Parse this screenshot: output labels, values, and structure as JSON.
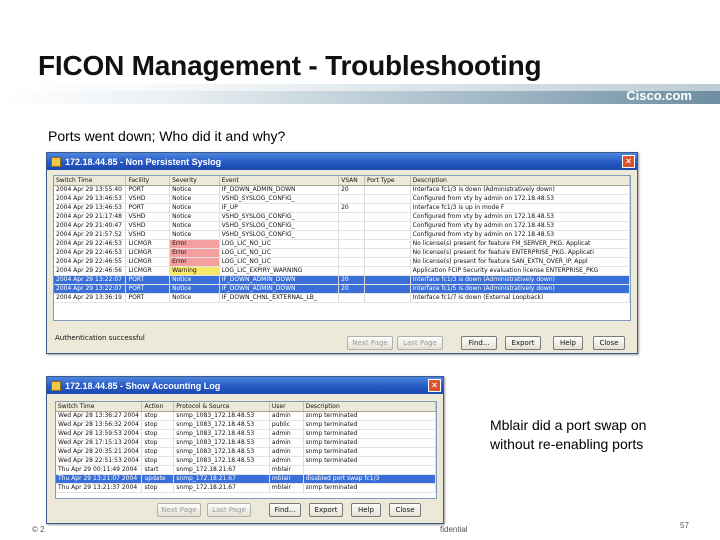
{
  "slide": {
    "title": "FICON Management - Troubleshooting",
    "brand": "Cisco.com",
    "subtitle": "Ports went down; Who did it and why?",
    "callout_line1": "Mblair did a port swap on",
    "callout_line2": "without re-enabling ports",
    "footer_left": "© 2",
    "footer_mid": "fidential",
    "page_number": "57"
  },
  "syslog_window": {
    "title": "172.18.44.85 - Non Persistent Syslog",
    "columns": [
      "Switch Time",
      "Facility",
      "Severity",
      "Event",
      "VSAN",
      "Port Type",
      "Description"
    ],
    "rows": [
      [
        "2004 Apr 29 13:55:40",
        "PORT",
        "Notice",
        "IF_DOWN_ADMIN_DOWN",
        "20",
        "",
        "Interface fc1/3 is down (Administratively down)"
      ],
      [
        "2004 Apr 29 13:46:53",
        "VSHD",
        "Notice",
        "VSHD_SYSLOG_CONFIG_",
        "",
        "",
        "Configured from vty by admin on 172.18.48.53"
      ],
      [
        "2004 Apr 29 13:46:53",
        "PORT",
        "Notice",
        "IF_UP",
        "20",
        "",
        "Interface fc1/3 is up in mode F"
      ],
      [
        "2004 Apr 29 21:17:48",
        "VSHD",
        "Notice",
        "VSHD_SYSLOG_CONFIG_",
        "",
        "",
        "Configured from vty by admin on 172.18.48.53"
      ],
      [
        "2004 Apr 29 21:40:47",
        "VSHD",
        "Notice",
        "VSHD_SYSLOG_CONFIG_",
        "",
        "",
        "Configured from vty by admin on 172.18.48.53"
      ],
      [
        "2004 Apr 29 21:57:52",
        "VSHD",
        "Notice",
        "VSHD_SYSLOG_CONFIG_",
        "",
        "",
        "Configured from vty by admin on 172.18.48.53"
      ],
      [
        "2004 Apr 29 22:46:53",
        "LICMGR",
        "Error",
        "LOG_LIC_NO_LIC",
        "",
        "",
        "No license(s) present for feature FM_SERVER_PKG. Applicat"
      ],
      [
        "2004 Apr 29 22:46:53",
        "LICMGR",
        "Error",
        "LOG_LIC_NO_LIC",
        "",
        "",
        "No license(s) present for feature ENTERPRISE_PKG. Applicati"
      ],
      [
        "2004 Apr 29 22:46:55",
        "LICMGR",
        "Error",
        "LOG_LIC_NO_LIC",
        "",
        "",
        "No license(s) present for feature SAN_EXTN_OVER_IP. Appl"
      ],
      [
        "2004 Apr 29 22:46:56",
        "LICMGR",
        "Warning",
        "LOG_LIC_EXPIRY_WARNING",
        "",
        "",
        "Application FCIP Security evaluation license ENTERPRISE_PKG"
      ],
      [
        "2004 Apr 29 13:22:07",
        "PORT",
        "Notice",
        "IF_DOWN_ADMIN_DOWN",
        "20",
        "",
        "Interface fc1/3 is down (Administratively down)"
      ],
      [
        "2004 Apr 29 13:22:07",
        "PORT",
        "Notice",
        "IF_DOWN_ADMIN_DOWN",
        "20",
        "",
        "Interface fc1/5 is down (Administratively down)"
      ],
      [
        "2004 Apr 29 13:36:19",
        "PORT",
        "Notice",
        "IF_DOWN_CHNL_EXTERNAL_LB_",
        "",
        "",
        "Interface fc1/7 is down (External Loopback)"
      ]
    ],
    "status": "Authentication successful",
    "buttons": {
      "next": "Next Page",
      "last": "Last Page",
      "find": "Find...",
      "export": "Export",
      "help": "Help",
      "close": "Close"
    }
  },
  "accounting_window": {
    "title": "172.18.44.85 - Show Accounting Log",
    "columns": [
      "Switch Time",
      "Action",
      "Protocol & Source",
      "User",
      "Description"
    ],
    "rows": [
      [
        "Wed Apr 28 13:36:27 2004",
        "stop",
        "snmp_1083_172.18.48.53",
        "admin",
        "snmp terminated"
      ],
      [
        "Wed Apr 28 13:56:32 2004",
        "stop",
        "snmp_1083_172.18.48.53",
        "public",
        "snmp terminated"
      ],
      [
        "Wed Apr 28 13:59:53 2004",
        "stop",
        "snmp_1083_172.18.48.53",
        "admin",
        "snmp terminated"
      ],
      [
        "Wed Apr 28 17:15:13 2004",
        "stop",
        "snmp_1083_172.18.48.53",
        "admin",
        "snmp terminated"
      ],
      [
        "Wed Apr 28 20:35:21 2004",
        "stop",
        "snmp_1083_172.18.48.53",
        "admin",
        "snmp terminated"
      ],
      [
        "Wed Apr 28 22:51:53 2004",
        "stop",
        "snmp_1083_172.18.48.53",
        "admin",
        "snmp terminated"
      ],
      [
        "Thu Apr 29 00:11:49 2004",
        "start",
        "snmp_172.18.21.67",
        "mblair",
        ""
      ],
      [
        "Thu Apr 29 13:21:07 2004",
        "update",
        "snmp_172.18.21.67",
        "mblair",
        "disabled port swap fc1/3"
      ],
      [
        "Thu Apr 29 13:21:37 2004",
        "stop",
        "snmp_172.18.21.67",
        "mblair",
        "snmp terminated"
      ]
    ],
    "buttons": {
      "next": "Next Page",
      "last": "Last Page",
      "find": "Find...",
      "export": "Export",
      "help": "Help",
      "close": "Close"
    }
  }
}
